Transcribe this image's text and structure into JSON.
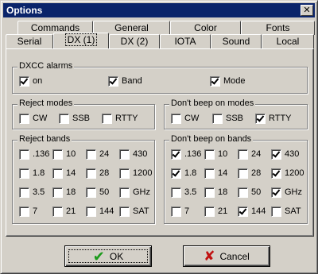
{
  "window": {
    "title": "Options",
    "close_glyph": "✕"
  },
  "tabs_back": [
    "Commands",
    "General",
    "Color",
    "Fonts"
  ],
  "tabs_front": [
    "Serial",
    "DX (1)",
    "DX (2)",
    "IOTA",
    "Sound",
    "Local"
  ],
  "active_tab": "DX (1)",
  "dxcc": {
    "label": "DXCC alarms",
    "items": [
      {
        "label": "on",
        "checked": true
      },
      {
        "label": "Band",
        "checked": true
      },
      {
        "label": "Mode",
        "checked": true
      }
    ]
  },
  "reject_modes": {
    "label": "Reject modes",
    "items": [
      {
        "label": "CW",
        "checked": false
      },
      {
        "label": "SSB",
        "checked": false
      },
      {
        "label": "RTTY",
        "checked": false
      }
    ]
  },
  "dont_beep_modes": {
    "label": "Don't beep on modes",
    "items": [
      {
        "label": "CW",
        "checked": false
      },
      {
        "label": "SSB",
        "checked": false
      },
      {
        "label": "RTTY",
        "checked": true
      }
    ]
  },
  "reject_bands": {
    "label": "Reject bands",
    "items": [
      {
        "label": ".136",
        "checked": false
      },
      {
        "label": "10",
        "checked": false
      },
      {
        "label": "24",
        "checked": false
      },
      {
        "label": "430",
        "checked": false
      },
      {
        "label": "1.8",
        "checked": false
      },
      {
        "label": "14",
        "checked": false
      },
      {
        "label": "28",
        "checked": false
      },
      {
        "label": "1200",
        "checked": false
      },
      {
        "label": "3.5",
        "checked": false
      },
      {
        "label": "18",
        "checked": false
      },
      {
        "label": "50",
        "checked": false
      },
      {
        "label": "GHz",
        "checked": false
      },
      {
        "label": "7",
        "checked": false
      },
      {
        "label": "21",
        "checked": false
      },
      {
        "label": "144",
        "checked": false
      },
      {
        "label": "SAT",
        "checked": false
      }
    ]
  },
  "dont_beep_bands": {
    "label": "Don't beep on bands",
    "items": [
      {
        "label": ".136",
        "checked": true
      },
      {
        "label": "10",
        "checked": false
      },
      {
        "label": "24",
        "checked": false
      },
      {
        "label": "430",
        "checked": true
      },
      {
        "label": "1.8",
        "checked": true
      },
      {
        "label": "14",
        "checked": false
      },
      {
        "label": "28",
        "checked": false
      },
      {
        "label": "1200",
        "checked": true
      },
      {
        "label": "3.5",
        "checked": false
      },
      {
        "label": "18",
        "checked": false
      },
      {
        "label": "50",
        "checked": false
      },
      {
        "label": "GHz",
        "checked": true
      },
      {
        "label": "7",
        "checked": false
      },
      {
        "label": "21",
        "checked": false
      },
      {
        "label": "144",
        "checked": true
      },
      {
        "label": "SAT",
        "checked": false
      }
    ]
  },
  "buttons": {
    "ok": {
      "label": "OK",
      "icon": "green-checkmark-icon"
    },
    "cancel": {
      "label": "Cancel",
      "icon": "red-x-icon"
    }
  },
  "colors": {
    "titlebar": "#0a246a",
    "face": "#d4d0c8",
    "ok_icon": "#1a9a1a",
    "cancel_icon": "#c01010"
  }
}
